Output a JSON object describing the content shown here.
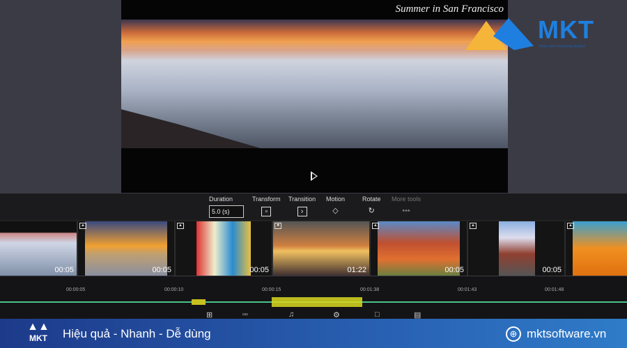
{
  "video": {
    "title": "Summer in San Francisco"
  },
  "watermark": {
    "brand": "MKT",
    "tagline": "Phần mềm Marketing đa kênh"
  },
  "toolbar": {
    "duration_label": "Duration",
    "duration_value": "5.0 (s)",
    "transform": "Transform",
    "transition": "Transition",
    "motion": "Motion",
    "rotate": "Rotate",
    "more_tools": "More tools"
  },
  "clips": [
    {
      "duration": "00:05"
    },
    {
      "duration": "00:05"
    },
    {
      "duration": "00:05"
    },
    {
      "duration": "01:22"
    },
    {
      "duration": "00:05"
    },
    {
      "duration": "00:05"
    }
  ],
  "timeline": {
    "ticks": [
      "00:00:05",
      "00:00:10",
      "00:00:15",
      "00:01:38",
      "00:01:43",
      "00:01:48"
    ]
  },
  "footer": {
    "slogan": "Hiệu quả - Nhanh - Dễ dùng",
    "website": "mktsoftware.vn",
    "logo": "MKT"
  },
  "colors": {
    "accent": "#1e7fe0",
    "footer": "#2a66b8",
    "wave_green": "#4cc38a",
    "wave_yellow": "#d8d820"
  }
}
